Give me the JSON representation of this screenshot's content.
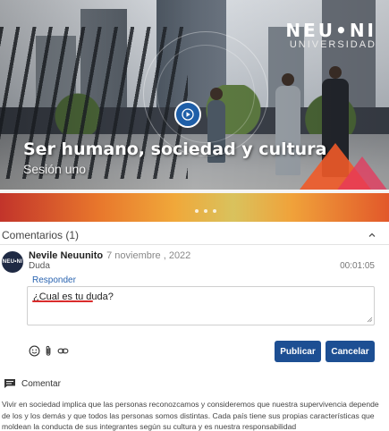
{
  "video": {
    "title": "Ser humano, sociedad y cultura",
    "subtitle": "Sesión uno",
    "brand_name": "NEU•NI",
    "brand_sub": "UNIVERSIDAD",
    "play_icon": "play-icon"
  },
  "comments": {
    "header": "Comentarios (1)",
    "toggle_icon": "chevron-up-icon",
    "items": [
      {
        "author": "Nevile Neuunito",
        "date": "7 noviembre , 2022",
        "type": "Duda",
        "timestamp": "00:01:05",
        "reply_label": "Responder",
        "avatar_text": "NEU•NI"
      }
    ],
    "reply_input": {
      "value": "¿Cual es tu duda?"
    },
    "tools": [
      "emoji-icon",
      "attachment-icon",
      "link-icon"
    ],
    "publish_label": "Publicar",
    "cancel_label": "Cancelar"
  },
  "section": {
    "label": "Comentar",
    "icon": "comment-icon",
    "text": "Vivir en sociedad implica que las personas reconozcamos y consideremos que nuestra supervivencia depende de los y los demás y que todos las personas somos distintas. Cada país tiene sus propias características que moldean la conducta de sus integrantes según su cultura y es nuestra responsabilidad"
  },
  "colors": {
    "primary": "#1d4f93",
    "link": "#2a64b0",
    "spell_error": "#d92b2b",
    "play_button": "#1f5fa8"
  }
}
